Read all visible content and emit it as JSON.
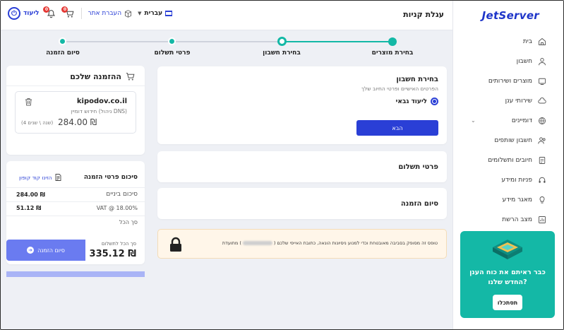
{
  "topbar": {
    "title": "עגלת קניות",
    "logout_label": "ליעוד",
    "cart_badge": "0",
    "bell_badge": "0",
    "transfer_label": "העברת אתר",
    "language": "עברית"
  },
  "sidebar": {
    "logo": "JetServer",
    "items": [
      {
        "label": "בית",
        "icon": "home-icon"
      },
      {
        "label": "חשבון",
        "icon": "user-icon"
      },
      {
        "label": "מוצרים ושירותים",
        "icon": "products-icon"
      },
      {
        "label": "שירותי ענן",
        "icon": "cloud-icon"
      },
      {
        "label": "דומיינים",
        "icon": "globe-icon"
      },
      {
        "label": "חשבון שותפים",
        "icon": "partners-icon"
      },
      {
        "label": "חיובים ותשלומים",
        "icon": "invoice-icon"
      },
      {
        "label": "פניות ומידע",
        "icon": "headset-icon"
      },
      {
        "label": "מאגר מידע",
        "icon": "bulb-icon"
      },
      {
        "label": "מצב הרשת",
        "icon": "chart-icon"
      }
    ],
    "promo": {
      "text": "כבר ראיתם את כוח הענן החדש שלנו?",
      "button": "תסתכלו"
    }
  },
  "stepper": {
    "steps": [
      {
        "label": "בחירת מוצרים",
        "state": "done"
      },
      {
        "label": "בחירת חשבון",
        "state": "current"
      },
      {
        "label": "פרטי תשלום",
        "state": "pending"
      },
      {
        "label": "סיום הזמנה",
        "state": "pending"
      }
    ],
    "active_color": "#14b8a6"
  },
  "account": {
    "title": "בחירת חשבון",
    "subtitle": "הפרטים האישיים ופרטי החיוב שלך",
    "option": "ליעוד גבאי",
    "next": "הבא"
  },
  "payment": {
    "title": "פרטי תשלום"
  },
  "complete": {
    "title": "סיום הזמנה"
  },
  "security": {
    "text_before": "טופס זה מסופק בסביבה מאובטחת וכדי למנוע ניסיונות הונאה, כתובת האייפי שלכם (",
    "text_after": ") מתועדת"
  },
  "order": {
    "title": "ההזמנה שלכם",
    "item": {
      "domain": "kipodov.co.il",
      "description": "חידוש דומיין (ניהול DNS)",
      "price": "284.00 ₪",
      "period": "(4 שנה \\ שנים)"
    }
  },
  "summary": {
    "title": "סיכום פרטי הזמנה",
    "coupon": "הזינו קוד קופון",
    "subtotal_label": "סיכום ביניים",
    "subtotal_value": "284.00 ₪",
    "vat_label": "VAT @ 18.00%",
    "vat_value": "51.12 ₪",
    "total_heading": "סך הכל",
    "total_label": "סך הכל לתשלום",
    "total_value": "335.12 ₪",
    "finish": "סיום הזמנה"
  },
  "colors": {
    "brand": "#1e35c9",
    "primary": "#2a3fd6",
    "teal": "#14b8a6"
  }
}
